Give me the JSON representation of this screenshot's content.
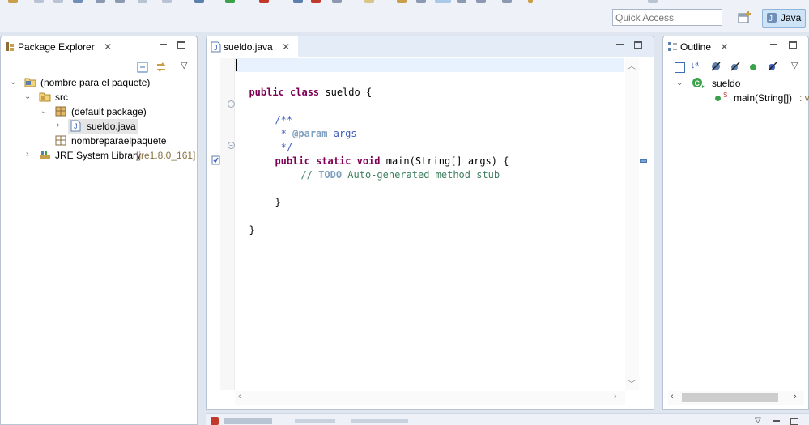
{
  "search": {
    "placeholder": "Quick Access"
  },
  "perspective": {
    "active_label": "Java"
  },
  "package_explorer": {
    "tab_label": "Package Explorer",
    "tree": {
      "project": "(nombre para el paquete)",
      "src": "src",
      "default_package": "(default package)",
      "file": "sueldo.java",
      "package2": "nombreparaelpaquete",
      "jre_label": "JRE System Library",
      "jre_version": "[jre1.8.0_161]"
    }
  },
  "editor": {
    "tab_label": "sueldo.java",
    "lines": {
      "class_kw": "public class",
      "class_name": " sueldo {",
      "doc_open": "/**",
      "doc_star": " * ",
      "doc_tag": "@param",
      "doc_rest": " args",
      "doc_close": " */",
      "method_kw": "public static void",
      "method_rest": " main(String[] args) {",
      "comment_prefix": "// ",
      "comment_todo": "TODO",
      "comment_rest": " Auto-generated method stub",
      "close_method": "}",
      "close_class": "}"
    }
  },
  "outline": {
    "tab_label": "Outline",
    "class_name": "sueldo",
    "method_label": "main(String[])",
    "method_type": " : v",
    "static_marker": "S"
  },
  "colors": {
    "accent": "#3f5fbf",
    "keyword": "#7f0055",
    "comment": "#3f7f5f",
    "jre_version": "#8a7342"
  }
}
